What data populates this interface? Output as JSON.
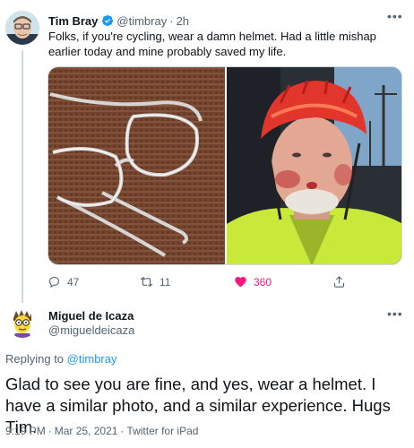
{
  "tweet1": {
    "author_name": "Tim Bray",
    "handle": "@timbray",
    "separator": "·",
    "time": "2h",
    "more_label": "•••",
    "text": "Folks, if you're cycling, wear a damn helmet. Had a little mishap earlier today and mine probably saved my life.",
    "photos": [
      {
        "icon": "broken-glasses-photo"
      },
      {
        "icon": "bloodied-cyclist-selfie-photo"
      }
    ],
    "actions": {
      "reply_count": "47",
      "retweet_count": "11",
      "like_count": "360",
      "liked": true
    }
  },
  "tweet2": {
    "author_name": "Miguel de Icaza",
    "handle": "@migueldeicaza",
    "more_label": "•••",
    "replying_prefix": "Replying to",
    "replying_to": "@timbray",
    "text": "Glad to see you are fine, and yes, wear a helmet.  I have a similar photo, and a similar experience.  Hugs Tim.",
    "time": "9:19 PM",
    "separator": "·",
    "date": "Mar 25, 2021",
    "client": "Twitter for iPad"
  },
  "colors": {
    "accent": "#1d9bf0",
    "like": "#f91880",
    "secondary_text": "#536471",
    "primary_text": "#0f1419"
  }
}
